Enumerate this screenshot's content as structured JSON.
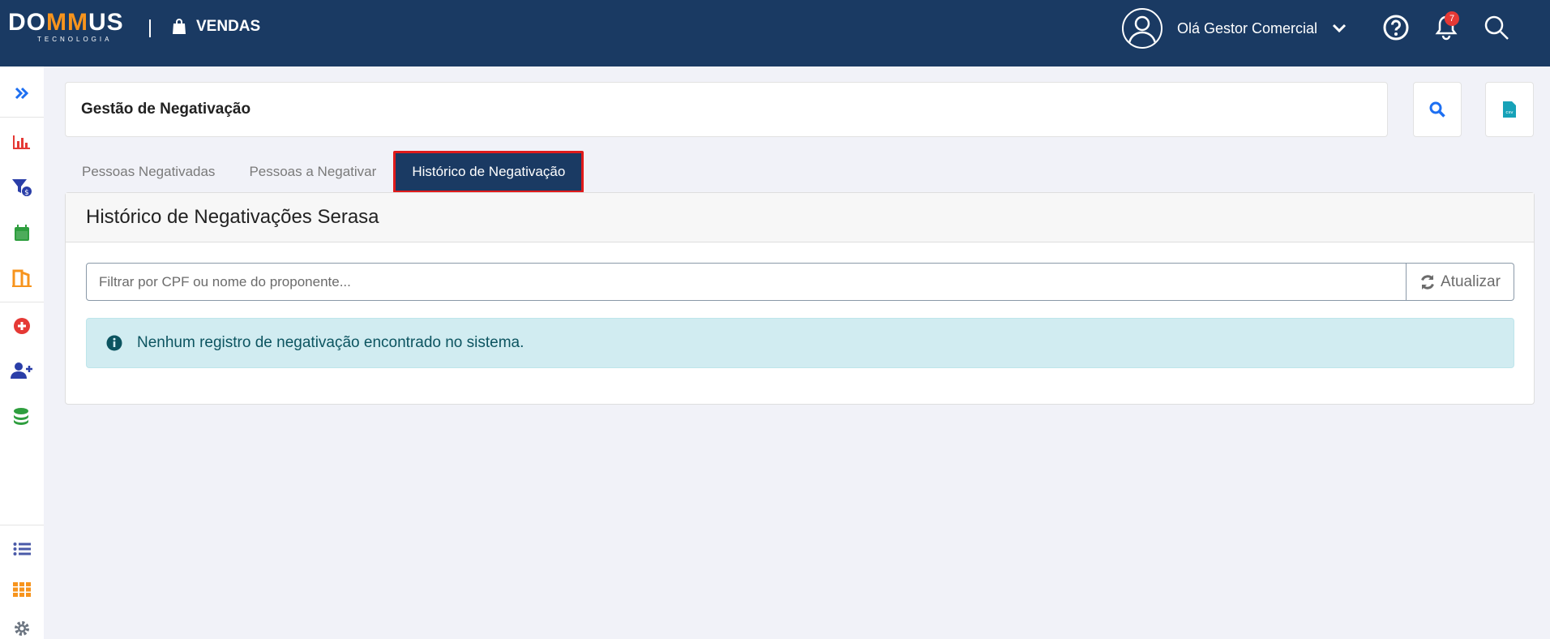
{
  "brand": {
    "name_prefix": "DO",
    "name_highlight": "MM",
    "name_suffix": "US",
    "tagline": "TECNOLOGIA",
    "accent_color": "#f7941d"
  },
  "header": {
    "module_label": "VENDAS",
    "greeting": "Olá Gestor Comercial",
    "notification_count": "7",
    "bar_color": "#1a3a63"
  },
  "sidebar": {
    "items": [
      {
        "icon": "double-chevron-right-icon"
      },
      {
        "icon": "bar-chart-icon"
      },
      {
        "icon": "filter-money-icon"
      },
      {
        "icon": "calendar-icon"
      },
      {
        "icon": "door-exit-icon"
      },
      {
        "icon": "plus-circle-icon"
      },
      {
        "icon": "user-plus-icon"
      },
      {
        "icon": "coins-stack-icon"
      },
      {
        "icon": "list-icon"
      },
      {
        "icon": "grid-icon"
      },
      {
        "icon": "gear-icon"
      }
    ]
  },
  "page": {
    "title": "Gestão de Negativação",
    "csv_label": "csv"
  },
  "tabs": [
    {
      "label": "Pessoas Negativadas",
      "active": false
    },
    {
      "label": "Pessoas a Negativar",
      "active": false
    },
    {
      "label": "Histórico de Negativação",
      "active": true
    }
  ],
  "content": {
    "title": "Histórico de Negativações Serasa",
    "filter_placeholder": "Filtrar por CPF ou nome do proponente...",
    "filter_value": "",
    "refresh_label": "Atualizar",
    "empty_message": "Nenhum registro de negativação encontrado no sistema."
  }
}
